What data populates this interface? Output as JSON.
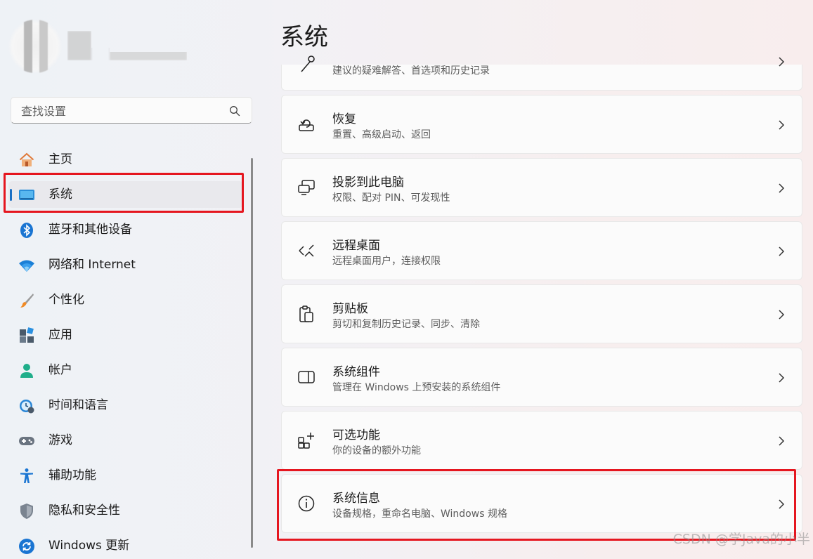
{
  "search": {
    "placeholder": "查找设置"
  },
  "nav": {
    "items": [
      {
        "label": "主页",
        "icon": "home-icon"
      },
      {
        "label": "系统",
        "icon": "system-display-icon",
        "active": true
      },
      {
        "label": "蓝牙和其他设备",
        "icon": "bluetooth-icon"
      },
      {
        "label": "网络和 Internet",
        "icon": "wifi-icon"
      },
      {
        "label": "个性化",
        "icon": "paintbrush-icon"
      },
      {
        "label": "应用",
        "icon": "apps-icon"
      },
      {
        "label": "帐户",
        "icon": "account-icon"
      },
      {
        "label": "时间和语言",
        "icon": "time-language-icon"
      },
      {
        "label": "游戏",
        "icon": "gamepad-icon"
      },
      {
        "label": "辅助功能",
        "icon": "accessibility-icon"
      },
      {
        "label": "隐私和安全性",
        "icon": "shield-icon"
      },
      {
        "label": "Windows 更新",
        "icon": "update-icon"
      }
    ]
  },
  "main": {
    "title": "系统",
    "cards": [
      {
        "title": "",
        "subtitle": "建议的疑难解答、首选项和历史记录",
        "icon": "troubleshoot-icon"
      },
      {
        "title": "恢复",
        "subtitle": "重置、高级启动、返回",
        "icon": "recovery-icon"
      },
      {
        "title": "投影到此电脑",
        "subtitle": "权限、配对 PIN、可发现性",
        "icon": "project-icon"
      },
      {
        "title": "远程桌面",
        "subtitle": "远程桌面用户，连接权限",
        "icon": "remote-desktop-icon"
      },
      {
        "title": "剪贴板",
        "subtitle": "剪切和复制历史记录、同步、清除",
        "icon": "clipboard-icon"
      },
      {
        "title": "系统组件",
        "subtitle": "管理在 Windows 上预安装的系统组件",
        "icon": "system-components-icon"
      },
      {
        "title": "可选功能",
        "subtitle": "你的设备的额外功能",
        "icon": "optional-features-icon"
      },
      {
        "title": "系统信息",
        "subtitle": "设备规格，重命名电脑、Windows 规格",
        "icon": "info-icon"
      }
    ]
  },
  "watermark": "CSDN @学Java的小半",
  "colors": {
    "accent": "#1a6fc4",
    "highlight_box": "#e5161f"
  }
}
